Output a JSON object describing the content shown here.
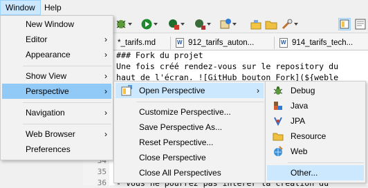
{
  "menubar": {
    "items": [
      "Window",
      "Help"
    ]
  },
  "tabs": [
    "*_tarifs.md",
    "912_tarifs_auton...",
    "914_tarifs_tech..."
  ],
  "editor": {
    "lines": [
      {
        "num": "",
        "text": "### Fork du projet"
      },
      {
        "num": "",
        "text": "Une fois créé rendez-vous sur le repository du"
      },
      {
        "num": "",
        "text": "haut de l'écran. ![GitHub bouton Fork](${weble"
      },
      {
        "num": "34",
        "text": ""
      },
      {
        "num": "35",
        "text": ""
      },
      {
        "num": "36",
        "text": "- Vous ne pourrez pas interer la creation du"
      }
    ]
  },
  "window_menu": {
    "items": [
      {
        "label": "New Window",
        "submenu": false
      },
      {
        "label": "Editor",
        "submenu": true
      },
      {
        "label": "Appearance",
        "submenu": true
      },
      {
        "label": "Show View",
        "submenu": true
      },
      {
        "label": "Perspective",
        "submenu": true
      },
      {
        "label": "Navigation",
        "submenu": true
      },
      {
        "label": "Web Browser",
        "submenu": true
      },
      {
        "label": "Preferences",
        "submenu": false
      }
    ],
    "arrow": "›"
  },
  "perspective_menu": {
    "items": [
      {
        "label": "Open Perspective",
        "submenu": true
      },
      {
        "label": "Customize Perspective...",
        "submenu": false
      },
      {
        "label": "Save Perspective As...",
        "submenu": false
      },
      {
        "label": "Reset Perspective...",
        "submenu": false
      },
      {
        "label": "Close Perspective",
        "submenu": false
      },
      {
        "label": "Close All Perspectives",
        "submenu": false
      }
    ]
  },
  "open_perspective_menu": {
    "items": [
      {
        "label": "Debug",
        "icon": "debug-icon"
      },
      {
        "label": "Java",
        "icon": "java-icon"
      },
      {
        "label": "JPA",
        "icon": "jpa-icon"
      },
      {
        "label": "Resource",
        "icon": "resource-icon"
      },
      {
        "label": "Web",
        "icon": "web-icon"
      },
      {
        "label": "Other...",
        "icon": ""
      }
    ]
  },
  "colors": {
    "menu_bg": "#f2f2f2",
    "highlight": "#91c9f7",
    "hover": "#cce8ff"
  }
}
